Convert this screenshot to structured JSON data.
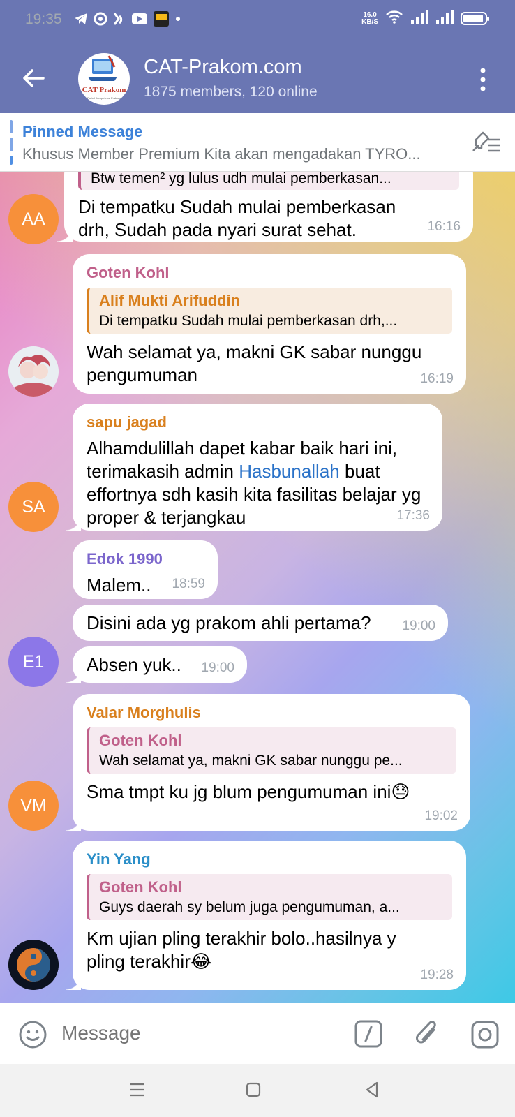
{
  "status_bar": {
    "time": "19:35",
    "net_speed_top": "16.0",
    "net_speed_bottom": "KB/S",
    "app_icons": [
      "telegram-icon",
      "browser-icon",
      "app-icon",
      "youtube-icon",
      "allo-bank-icon"
    ],
    "allo_label": "allo bank"
  },
  "header": {
    "title": "CAT-Prakom.com",
    "subtitle": "1875 members, 120 online",
    "avatar_text": "CAT Prakom",
    "avatar_subtext": "Portal Kompetensi Prakom"
  },
  "pinned": {
    "title": "Pinned Message",
    "text": "Khusus Member Premium Kita akan mengadakan TYRO..."
  },
  "messages": [
    {
      "reply_text": "Btw temen² yg lulus udh mulai pemberkasan...",
      "text": "Di tempatku Sudah mulai pemberkasan drh, Sudah pada nyari surat sehat.",
      "time": "16:16",
      "avatar": "AA"
    },
    {
      "sender": "Goten Kohl",
      "reply_name": "Alif Mukti Arifuddin",
      "reply_text": "Di tempatku Sudah mulai pemberkasan drh,...",
      "text": "Wah selamat ya, makni GK sabar nunggu pengumuman",
      "time": "16:19"
    },
    {
      "sender": "sapu jagad",
      "text_before": "Alhamdulillah dapet kabar baik hari ini, terimakasih admin ",
      "link": "Hasbunallah",
      "text_after": " buat effortnya sdh kasih kita fasilitas belajar yg proper & terjangkau",
      "time": "17:36",
      "avatar": "SA"
    },
    {
      "sender": "Edok 1990",
      "text": "Malem..",
      "time": "18:59"
    },
    {
      "text": "Disini ada yg prakom ahli pertama?",
      "time": "19:00"
    },
    {
      "text": "Absen yuk..",
      "time": "19:00",
      "avatar": "E1"
    },
    {
      "sender": "Valar Morghulis",
      "reply_name": "Goten Kohl",
      "reply_text": "Wah selamat ya, makni GK sabar nunggu pe...",
      "text": "Sma tmpt ku jg blum pengumuman ini😓",
      "time": "19:02",
      "avatar": "VM"
    },
    {
      "sender": "Yin Yang",
      "reply_name": "Goten Kohl",
      "reply_text": "Guys daerah sy belum juga pengumuman, a...",
      "text": "Km ujian pling terakhir bolo..hasilnya y pling terakhir😂",
      "time": "19:28"
    }
  ],
  "input": {
    "placeholder": "Message"
  },
  "colors": {
    "header_bg": "#6a76b3",
    "goten": "#c0608a",
    "sapu": "#d9801e",
    "edok": "#7b66cc",
    "valar": "#d9801e",
    "yinyang": "#2a8ec8",
    "alif": "#d9801e",
    "av_orange": "#f7903a",
    "av_purple": "#8c77e8"
  }
}
